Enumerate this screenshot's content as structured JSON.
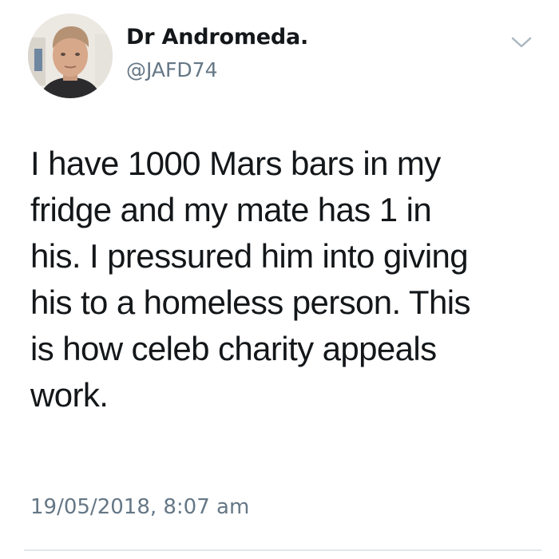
{
  "author": {
    "display_name": "Dr Andromeda.",
    "handle": "@JAFD74"
  },
  "tweet": {
    "lines": [
      "I have 1000 Mars bars in my",
      "fridge and my mate has 1 in",
      "his. I pressured him into giving",
      "his to a homeless person. This",
      "is how celeb charity appeals",
      "work."
    ],
    "timestamp": "19/05/2018, 8:07 am"
  },
  "icons": {
    "menu": "chevron-down-icon",
    "avatar": "profile-photo"
  },
  "colors": {
    "primary_text": "#14171a",
    "secondary_text": "#657786",
    "divider": "#e1e8ed",
    "background": "#ffffff"
  }
}
